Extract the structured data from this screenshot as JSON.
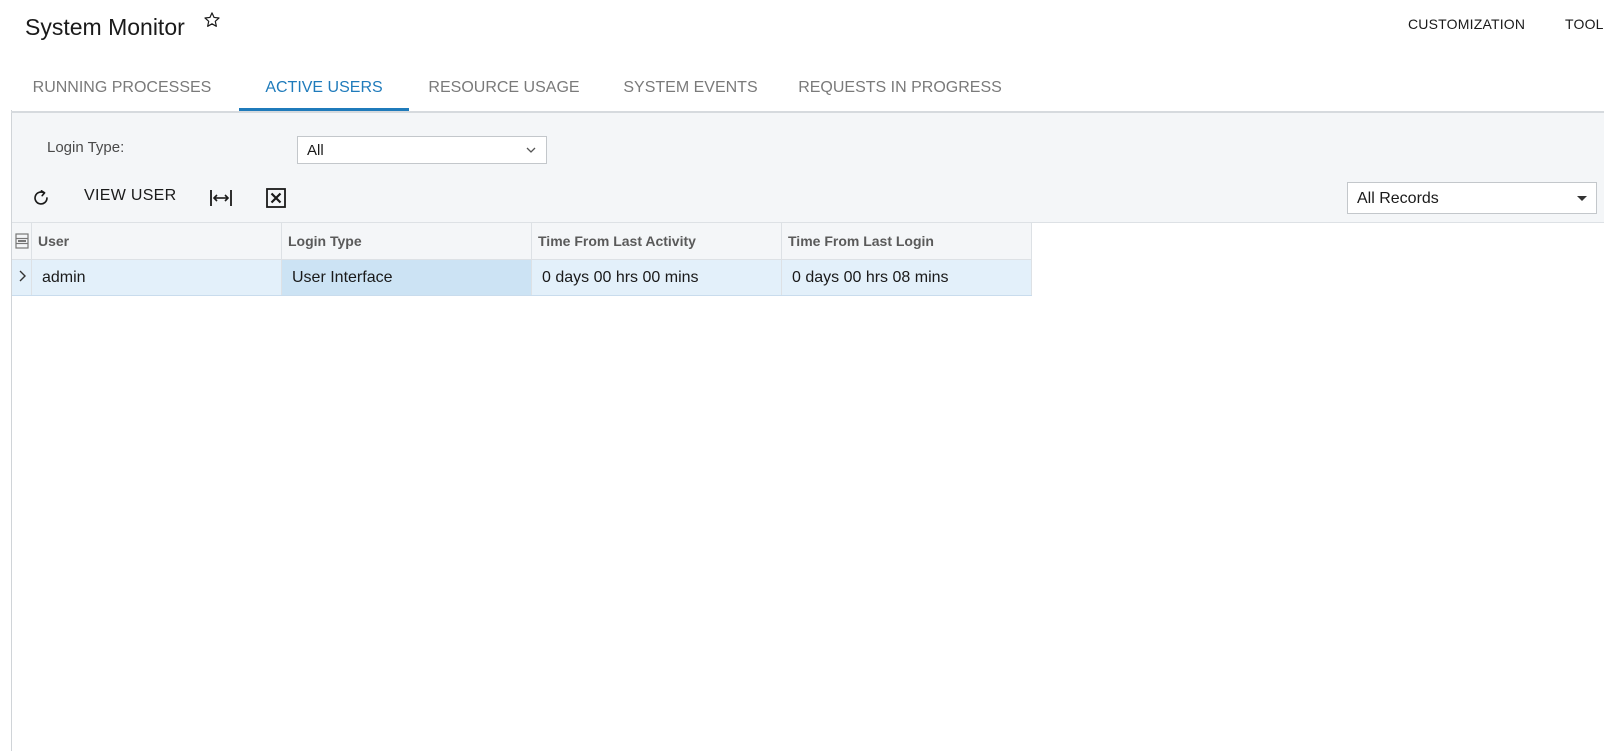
{
  "header": {
    "title": "System Monitor",
    "star_icon": "star-outline-icon",
    "links": [
      "CUSTOMIZATION",
      "TOOLS"
    ]
  },
  "tabs": [
    {
      "label": "RUNNING PROCESSES",
      "active": false
    },
    {
      "label": "ACTIVE USERS",
      "active": true
    },
    {
      "label": "RESOURCE USAGE",
      "active": false
    },
    {
      "label": "SYSTEM EVENTS",
      "active": false
    },
    {
      "label": "REQUESTS IN PROGRESS",
      "active": false
    }
  ],
  "filter": {
    "login_type_label": "Login Type:",
    "login_type_value": "All"
  },
  "toolbar": {
    "refresh_icon": "refresh-icon",
    "view_user_label": "VIEW USER",
    "fit_icon": "fit-columns-icon",
    "export_icon": "excel-export-icon",
    "records_filter_value": "All Records"
  },
  "grid": {
    "columns": [
      "User",
      "Login Type",
      "Time From Last Activity",
      "Time From Last Login"
    ],
    "rows": [
      {
        "user": "admin",
        "login_type": "User Interface",
        "time_from_last_activity": "0 days 00 hrs 00 mins",
        "time_from_last_login": "0 days 00 hrs 08 mins"
      }
    ]
  },
  "colors": {
    "accent": "#1f7bbb",
    "selected_row": "#e3f0fa",
    "selected_cell": "#cce3f4",
    "panel_bg": "#f4f6f8"
  }
}
